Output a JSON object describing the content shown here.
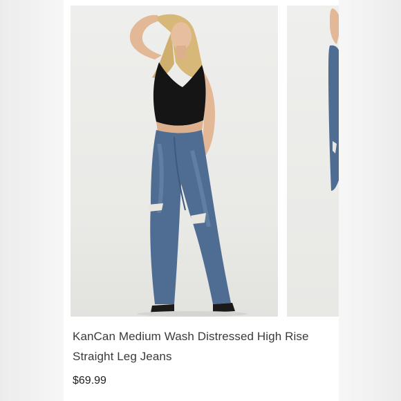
{
  "product": {
    "title": "KanCan Medium Wash Distressed High Rise Straight Leg Jeans",
    "price": "$69.99"
  },
  "gallery": {
    "images": [
      {
        "description_icon": "product-photo-front"
      },
      {
        "description_icon": "product-photo-side"
      }
    ]
  },
  "colors": {
    "denim": "#4f6d92",
    "top": "#151515",
    "skin": "#e2b896",
    "hair": "#d8b878"
  }
}
